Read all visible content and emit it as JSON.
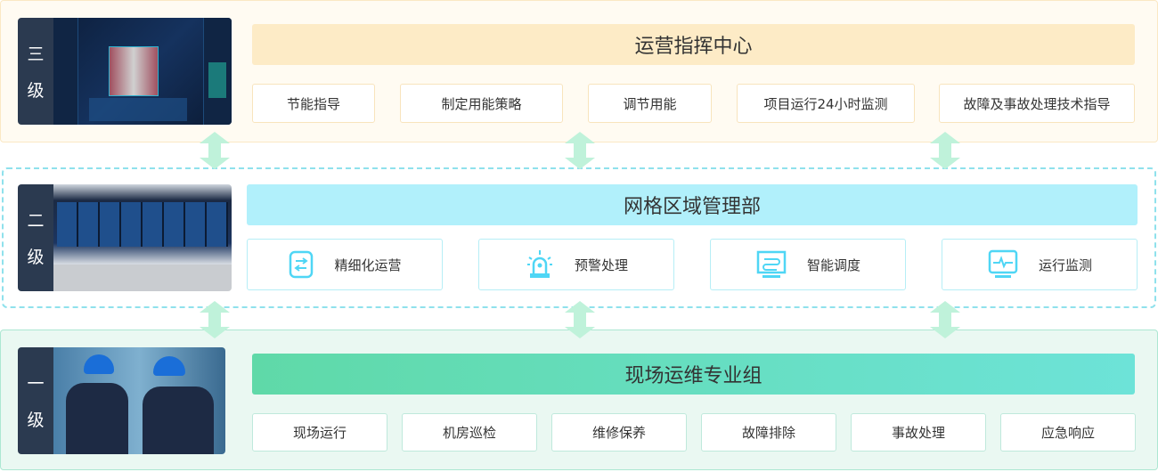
{
  "levels": [
    {
      "label_chars": [
        "三",
        "级"
      ],
      "title": "运营指挥中心",
      "items": [
        "节能指导",
        "制定用能策略",
        "调节用能",
        "项目运行24小时监测",
        "故障及事故处理技术指导"
      ]
    },
    {
      "label_chars": [
        "二",
        "级"
      ],
      "title": "网格区域管理部",
      "items": [
        {
          "label": "精细化运营",
          "icon": "sliders-icon"
        },
        {
          "label": "预警处理",
          "icon": "alarm-light-icon"
        },
        {
          "label": "智能调度",
          "icon": "dispatch-monitor-icon"
        },
        {
          "label": "运行监测",
          "icon": "heartbeat-monitor-icon"
        }
      ]
    },
    {
      "label_chars": [
        "一",
        "级"
      ],
      "title": "现场运维专业组",
      "items": [
        "现场运行",
        "机房巡检",
        "维修保养",
        "故障排除",
        "事故处理",
        "应急响应"
      ]
    }
  ],
  "colors": {
    "level3_header": "#fdebc6",
    "level2_header": "#b1f0fb",
    "level1_header_start": "#5fd9a8",
    "level1_header_end": "#6de3d8",
    "icon": "#4fd6f5",
    "arrow": "#bff2da",
    "label_bg": "#2b3a50"
  }
}
